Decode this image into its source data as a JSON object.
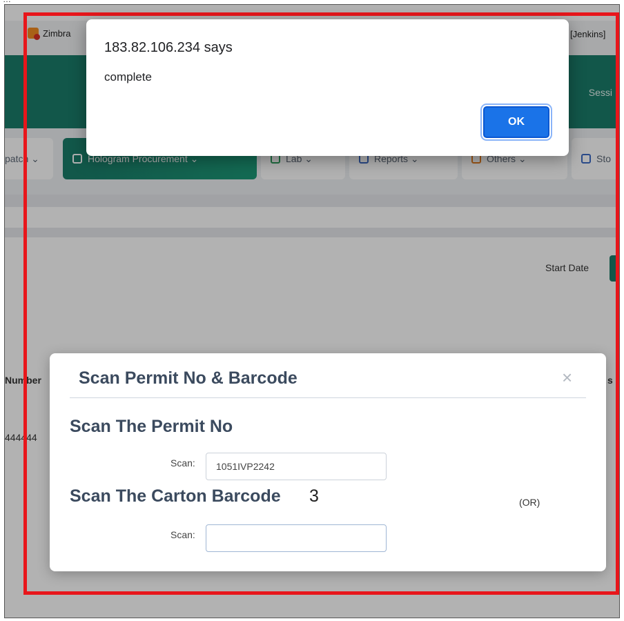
{
  "browser": {
    "tab_zimbra": "Zimbra",
    "tab_jenkins": "[Jenkins]"
  },
  "header": {
    "session_label": "Sessi"
  },
  "nav": {
    "items": [
      {
        "label": "Dispatch",
        "display": "patch ⌄"
      },
      {
        "label": "Hologram Procurement",
        "display": "Hologram Procurement ⌄"
      },
      {
        "label": "Lab",
        "display": "Lab ⌄"
      },
      {
        "label": "Reports",
        "display": "Reports ⌄"
      },
      {
        "label": "Others",
        "display": "Others ⌄"
      },
      {
        "label": "Sto",
        "display": "Sto"
      }
    ]
  },
  "filters": {
    "start_date_label": "Start Date"
  },
  "table": {
    "header_left": "Number",
    "header_right": "s",
    "row_value": "444444"
  },
  "modal": {
    "title": "Scan Permit No & Barcode",
    "close_glyph": "×",
    "permit_section_title": "Scan The Permit No",
    "permit_scan_label": "Scan:",
    "permit_scan_value": "1051IVP2242",
    "carton_section_title": "Scan The Carton Barcode",
    "carton_count": "3",
    "carton_scan_label": "Scan:",
    "carton_scan_value": "",
    "or_label": "(OR)"
  },
  "alert": {
    "title": "183.82.106.234 says",
    "message": "complete",
    "ok_label": "OK"
  },
  "annotation": {
    "highlight_color": "#e8161b"
  },
  "colors": {
    "brand_teal": "#1b7d6a",
    "button_blue": "#1a73e8"
  }
}
